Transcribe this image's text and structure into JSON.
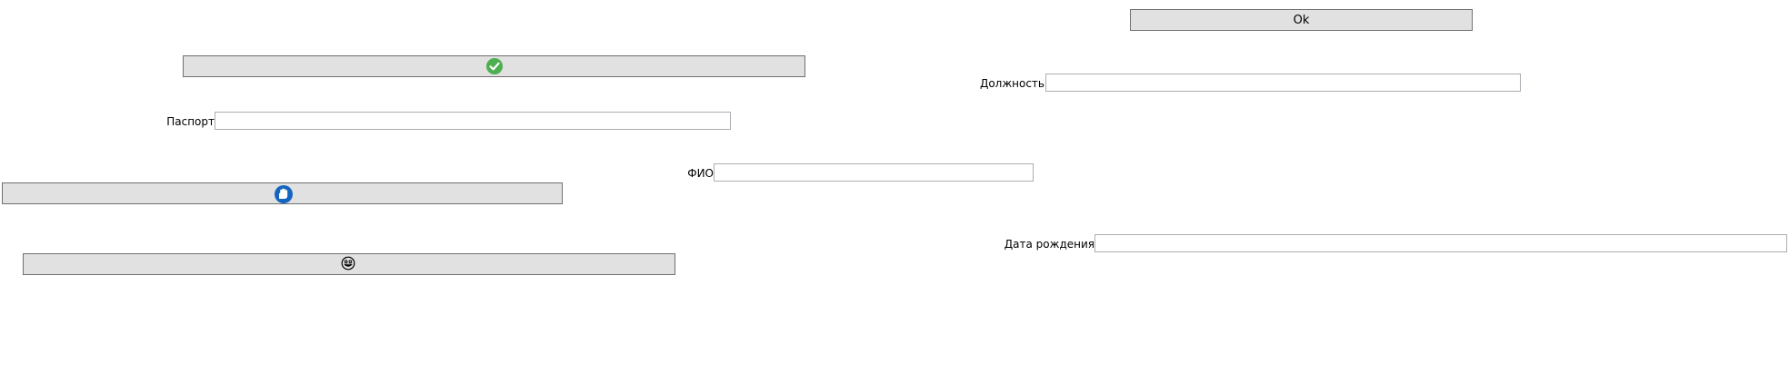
{
  "window": {
    "ok_button": {
      "label": "Ok"
    },
    "buttons": {
      "confirm": {
        "icon": "check-circle-icon",
        "color": "#4caf50"
      },
      "scan": {
        "icon": "blue-hand-icon",
        "color": "#1565c0"
      },
      "face": {
        "icon": "emoji-face-icon",
        "color": "#000000"
      }
    },
    "fields": {
      "position": {
        "label": "Должность",
        "value": ""
      },
      "passport": {
        "label": "Паспорт",
        "value": ""
      },
      "full_name": {
        "label": "ФИО",
        "value": ""
      },
      "birth_date": {
        "label": "Дата рождения",
        "value": ""
      }
    }
  }
}
